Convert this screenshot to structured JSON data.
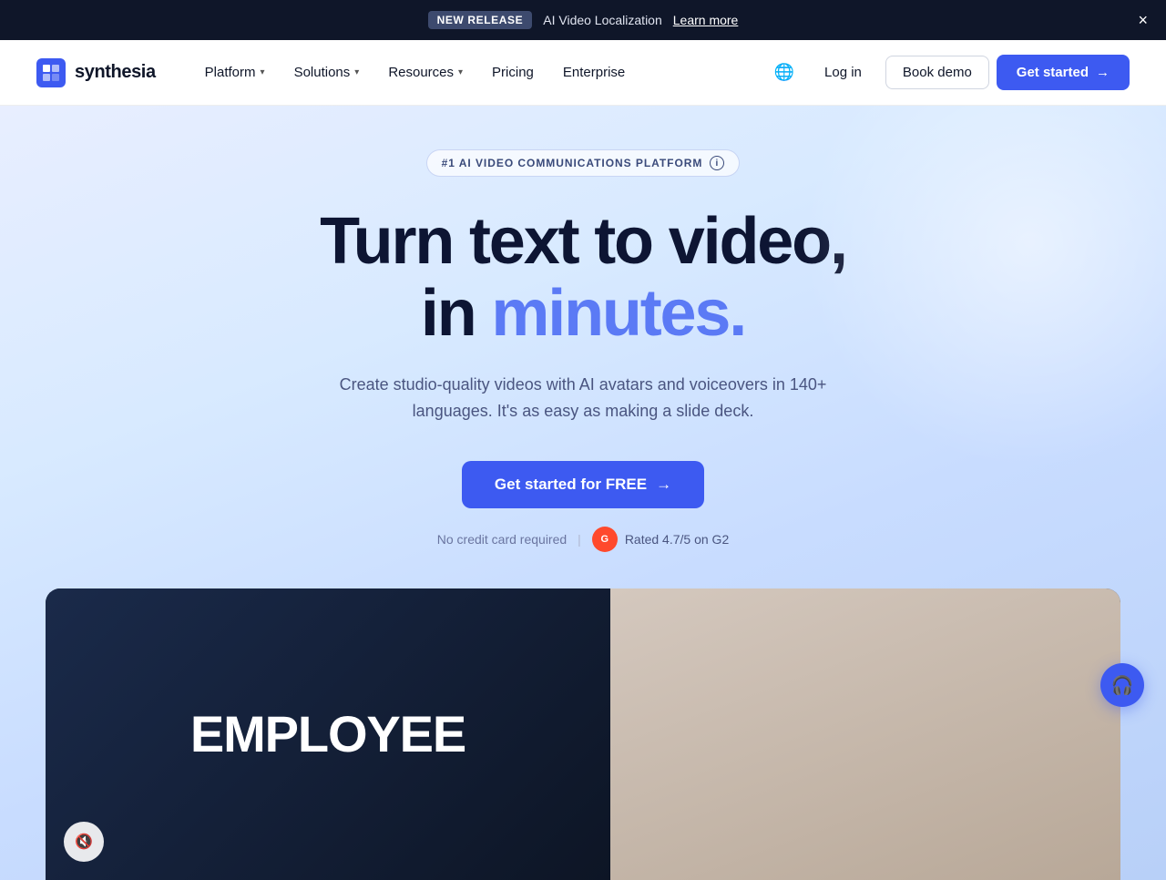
{
  "announcement": {
    "badge": "NEW RELEASE",
    "text": "AI Video Localization",
    "link_text": "Learn more",
    "close_label": "×"
  },
  "nav": {
    "logo_text": "synthesia",
    "items": [
      {
        "label": "Platform",
        "has_dropdown": true
      },
      {
        "label": "Solutions",
        "has_dropdown": true
      },
      {
        "label": "Resources",
        "has_dropdown": true
      },
      {
        "label": "Pricing",
        "has_dropdown": false
      },
      {
        "label": "Enterprise",
        "has_dropdown": false
      }
    ],
    "log_in": "Log in",
    "book_demo": "Book demo",
    "get_started": "Get started",
    "get_started_arrow": "→"
  },
  "hero": {
    "badge_text": "#1 AI VIDEO COMMUNICATIONS PLATFORM",
    "title_part1": "Turn text to video,",
    "title_part2": "in ",
    "title_highlight": "minutes.",
    "subtitle": "Create studio-quality videos with AI avatars and voiceovers in 140+ languages. It's as easy as making a slide deck.",
    "cta_text": "Get started for FREE",
    "cta_arrow": "→",
    "no_credit_card": "No credit card required",
    "g2_label": "G",
    "rated": "Rated 4.7/5 on G2"
  },
  "video": {
    "text": "EMPLOYEE",
    "mute_icon": "🔇"
  },
  "chat": {
    "icon": "🎧"
  },
  "colors": {
    "accent": "#3d5af1",
    "dark": "#0f1629",
    "highlight": "#5b7af5"
  }
}
